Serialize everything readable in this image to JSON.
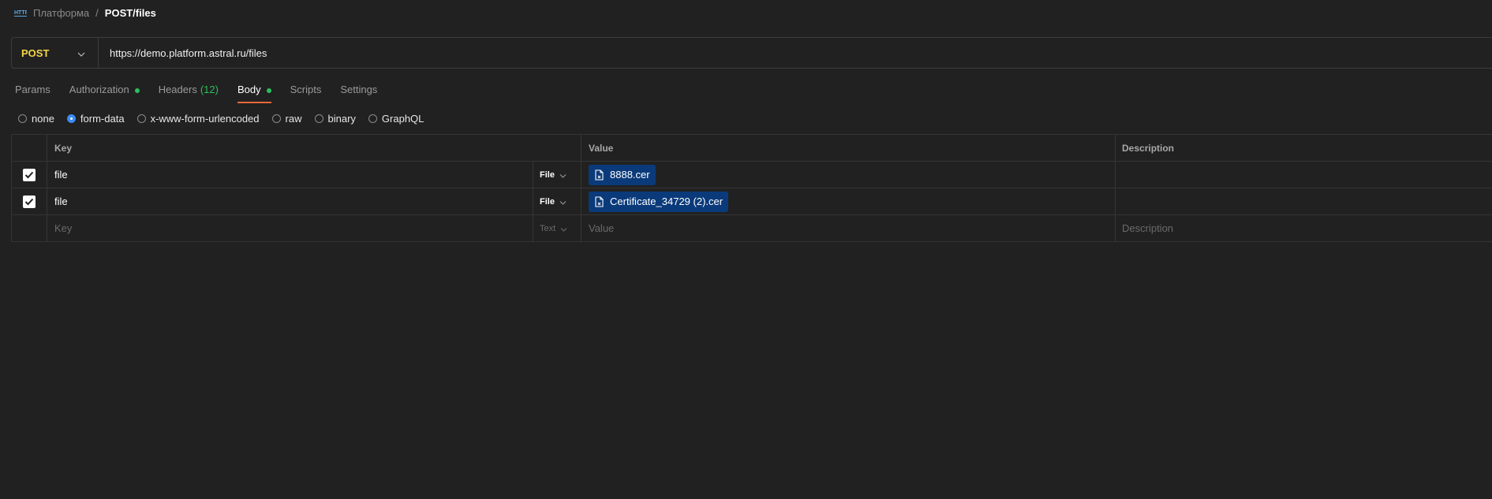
{
  "breadcrumb": {
    "icon": "http-icon",
    "parent": "Платформа",
    "separator": "/",
    "current": "POST/files"
  },
  "request": {
    "method": "POST",
    "url": "https://demo.platform.astral.ru/files"
  },
  "tabs": [
    {
      "label": "Params",
      "active": false
    },
    {
      "label": "Authorization",
      "indicator": true
    },
    {
      "label": "Headers",
      "count": "(12)"
    },
    {
      "label": "Body",
      "indicator": true,
      "active": true
    },
    {
      "label": "Scripts"
    },
    {
      "label": "Settings"
    }
  ],
  "body_types": [
    {
      "label": "none",
      "selected": false
    },
    {
      "label": "form-data",
      "selected": true
    },
    {
      "label": "x-www-form-urlencoded",
      "selected": false
    },
    {
      "label": "raw",
      "selected": false
    },
    {
      "label": "binary",
      "selected": false
    },
    {
      "label": "GraphQL",
      "selected": false
    }
  ],
  "table": {
    "headers": {
      "key": "Key",
      "value": "Value",
      "description": "Description"
    },
    "rows": [
      {
        "checked": true,
        "key": "file",
        "type": "File",
        "value": "8888.cer",
        "description": ""
      },
      {
        "checked": true,
        "key": "file",
        "type": "File",
        "value": "Certificate_34729 (2).cer",
        "description": ""
      }
    ],
    "new_row": {
      "key_placeholder": "Key",
      "type": "Text",
      "value_placeholder": "Value",
      "description_placeholder": "Description"
    }
  },
  "colors": {
    "method": "#f5d547",
    "active_tab_underline": "#e8683a",
    "indicator": "#2bbf5d",
    "radio_selected": "#3b8cf3",
    "file_chip": "#0a3a7a"
  }
}
